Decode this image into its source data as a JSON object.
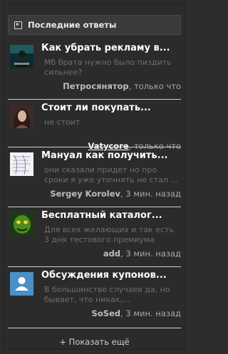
{
  "header": {
    "title": "Последние ответы"
  },
  "items": [
    {
      "title": "Как убрать рекламу в...",
      "text": "Мб брата нужно было пиздить сильнее?",
      "author": "Петросянятор",
      "time": ", только что",
      "avatar": "dark-figure-avatar"
    },
    {
      "title": "Стоит ли покупать...",
      "text": "не стоит",
      "author": "Vatycore",
      "time": ", только что",
      "avatar": "portrait-avatar"
    },
    {
      "title": "Мануал как получить...",
      "text": "они сказали придет но про сроки я уже уточнять не стал ...",
      "author": "Sergey Korolev",
      "time": ", 3 мин. назад",
      "avatar": "sketch-avatar"
    },
    {
      "title": "Бесплатный каталог...",
      "text": "Для всех желающих и так есть 3 дня тестового премиума",
      "author": "add",
      "time": ", 3 мин. назад",
      "avatar": "green-creature-avatar"
    },
    {
      "title": "Обсуждения купонов...",
      "text": "В большинстве случаев да, но бывает, что никак,...",
      "author": "SoSed",
      "time": ", 3 мин. назад",
      "avatar": "default-user-avatar"
    }
  ],
  "show_more": "+ Показать ещё",
  "colors": {
    "background": "#2b2b2b",
    "default_avatar": "#4a90c8",
    "divider": "#d0d0d0"
  }
}
